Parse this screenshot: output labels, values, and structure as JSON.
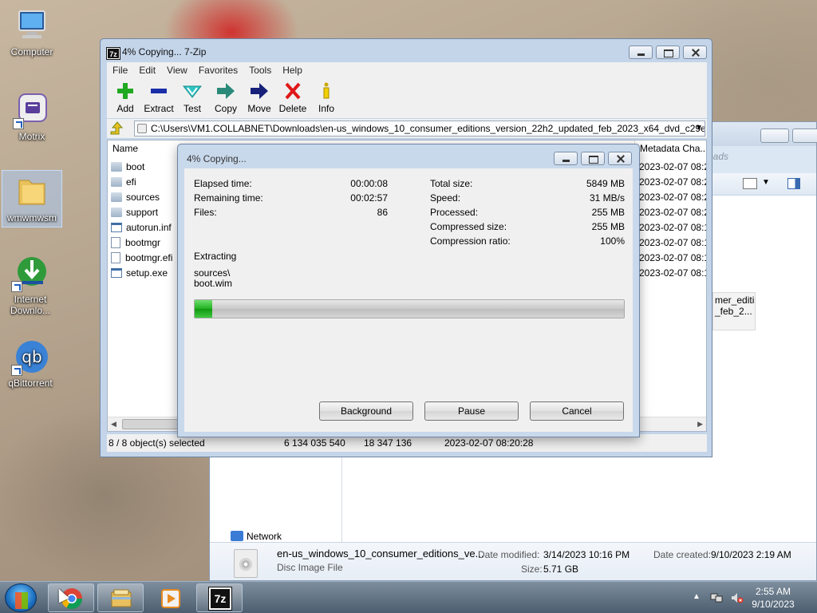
{
  "desktop": {
    "icons": [
      {
        "label": "Computer"
      },
      {
        "label": "Motrix"
      },
      {
        "label": "wmwmwsm"
      },
      {
        "label": "Internet Downlo..."
      },
      {
        "label": "qBittorrent"
      }
    ]
  },
  "explorer": {
    "search_placeholder": "oads",
    "thumb_label_line1": "mer_editi",
    "thumb_label_line2": "_feb_2...",
    "network_label": "Network",
    "details": {
      "name": "en-us_windows_10_consumer_editions_ve...",
      "type": "Disc Image File",
      "date_modified_label": "Date modified:",
      "date_modified_value": "3/14/2023 10:16 PM",
      "size_label": "Size:",
      "size_value": "5.71 GB",
      "date_created_label": "Date created:",
      "date_created_value": "9/10/2023 2:19 AM"
    }
  },
  "zip": {
    "title": "4% Copying... 7-Zip",
    "app_icon_text": "7z",
    "menu": [
      "File",
      "Edit",
      "View",
      "Favorites",
      "Tools",
      "Help"
    ],
    "toolbar": [
      {
        "label": "Add",
        "icon": "add-icon"
      },
      {
        "label": "Extract",
        "icon": "extract-icon"
      },
      {
        "label": "Test",
        "icon": "test-icon"
      },
      {
        "label": "Copy",
        "icon": "copy-icon"
      },
      {
        "label": "Move",
        "icon": "move-icon"
      },
      {
        "label": "Delete",
        "icon": "delete-icon"
      },
      {
        "label": "Info",
        "icon": "info-icon"
      }
    ],
    "address": "C:\\Users\\VM1.COLLABNET\\Downloads\\en-us_windows_10_consumer_editions_version_22h2_updated_feb_2023_x64_dvd_c29e4b",
    "columns": {
      "name": "Name",
      "meta": "Metadata Cha..."
    },
    "files": [
      {
        "name": "boot",
        "kind": "folder",
        "meta": "2023-02-07 08:2"
      },
      {
        "name": "efi",
        "kind": "folder",
        "meta": "2023-02-07 08:2"
      },
      {
        "name": "sources",
        "kind": "folder",
        "meta": "2023-02-07 08:2"
      },
      {
        "name": "support",
        "kind": "folder",
        "meta": "2023-02-07 08:2"
      },
      {
        "name": "autorun.inf",
        "kind": "file",
        "meta": "2023-02-07 08:1"
      },
      {
        "name": "bootmgr",
        "kind": "file",
        "meta": "2023-02-07 08:1"
      },
      {
        "name": "bootmgr.efi",
        "kind": "file",
        "meta": "2023-02-07 08:1"
      },
      {
        "name": "setup.exe",
        "kind": "exe",
        "meta": "2023-02-07 08:1"
      }
    ],
    "status": {
      "selected": "8 / 8 object(s) selected",
      "size": "6 134 035 540",
      "packed": "18 347 136",
      "date": "2023-02-07 08:20:28"
    }
  },
  "dialog": {
    "title": "4% Copying...",
    "elapsed_label": "Elapsed time:",
    "elapsed_value": "00:00:08",
    "remaining_label": "Remaining time:",
    "remaining_value": "00:02:57",
    "files_label": "Files:",
    "files_value": "86",
    "total_label": "Total size:",
    "total_value": "5849 MB",
    "speed_label": "Speed:",
    "speed_value": "31 MB/s",
    "processed_label": "Processed:",
    "processed_value": "255 MB",
    "compressed_label": "Compressed size:",
    "compressed_value": "255 MB",
    "ratio_label": "Compression ratio:",
    "ratio_value": "100%",
    "operation": "Extracting",
    "current_path": "sources\\",
    "current_file": "boot.wim",
    "progress_percent": 4,
    "buttons": {
      "background": "Background",
      "pause": "Pause",
      "cancel": "Cancel"
    }
  },
  "taskbar": {
    "apps": [
      "chrome-icon",
      "file-explorer-icon",
      "media-player-icon",
      "7zip-icon"
    ],
    "active_app_text": "7z",
    "time": "2:55 AM",
    "date": "9/10/2023"
  },
  "colors": {
    "progress": "#20b020",
    "accent": "#1b6fc0"
  }
}
